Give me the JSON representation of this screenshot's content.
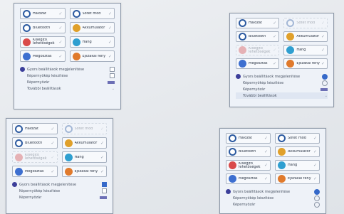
{
  "panels": [
    {
      "tiles": [
        {
          "label": "Hálózat",
          "icon": "wifi-icon",
          "color": "#2c5aa0",
          "dim": false
        },
        {
          "label": "Sötét mód",
          "icon": "moon-icon",
          "color": "#2c5aa0",
          "dim": false
        },
        {
          "label": "Bluetooth",
          "icon": "bluetooth-icon",
          "color": "#2c5aa0",
          "dim": false
        },
        {
          "label": "Akkumulátor",
          "icon": "battery-icon",
          "color": "#e0a02a",
          "dim": false
        },
        {
          "label": "Kisegítő lehetőségek",
          "icon": "accessibility-icon",
          "color": "#d94a4a",
          "dim": false
        },
        {
          "label": "Hang",
          "icon": "volume-icon",
          "color": "#2f9fd0",
          "dim": false
        },
        {
          "label": "Megosztás",
          "icon": "share-icon",
          "color": "#3d6fd0",
          "dim": false
        },
        {
          "label": "Éjszakai fény",
          "icon": "night-light-icon",
          "color": "#e07a2c",
          "dim": false
        }
      ],
      "options": [
        {
          "label": "Gyors beállítások megjelenítése",
          "kind": "checkbox",
          "on": false,
          "icon_color": "#3c3f9a"
        },
        {
          "label": "Képernyőkép készítése",
          "kind": "checkbox",
          "on": false,
          "icon_color": ""
        },
        {
          "label": "Képernyőzár",
          "kind": "bar",
          "on": false,
          "icon_color": ""
        },
        {
          "label": "További beállítások",
          "kind": "dropdown",
          "on": false,
          "icon_color": ""
        }
      ]
    },
    {
      "tiles": [
        {
          "label": "Hálózat",
          "icon": "wifi-icon",
          "color": "#2c5aa0",
          "dim": false
        },
        {
          "label": "Sötét mód",
          "icon": "moon-icon",
          "color": "#2c5aa0",
          "dim": true
        },
        {
          "label": "Bluetooth",
          "icon": "bluetooth-icon",
          "color": "#2c5aa0",
          "dim": false
        },
        {
          "label": "Akkumulátor",
          "icon": "battery-icon",
          "color": "#e0a02a",
          "dim": false
        },
        {
          "label": "Kisegítő lehetőségek",
          "icon": "accessibility-icon",
          "color": "#d94a4a",
          "dim": true
        },
        {
          "label": "Hang",
          "icon": "volume-icon",
          "color": "#2f9fd0",
          "dim": false
        },
        {
          "label": "Megosztás",
          "icon": "share-icon",
          "color": "#3d6fd0",
          "dim": false
        },
        {
          "label": "Éjszakai fény",
          "icon": "night-light-icon",
          "color": "#e07a2c",
          "dim": false
        }
      ],
      "options": [
        {
          "label": "Gyors beállítások megjelenítése",
          "kind": "radio",
          "on": true,
          "icon_color": "#3c3f9a"
        },
        {
          "label": "Képernyőkép készítése",
          "kind": "radio",
          "on": false,
          "icon_color": ""
        },
        {
          "label": "Képernyőzár",
          "kind": "bar",
          "on": false,
          "icon_color": ""
        },
        {
          "label": "További beállítások",
          "kind": "dropdown",
          "on": false,
          "icon_color": "",
          "selected": true
        }
      ]
    },
    {
      "tiles": [
        {
          "label": "Hálózat",
          "icon": "wifi-icon",
          "color": "#2c5aa0",
          "dim": false
        },
        {
          "label": "Sötét mód",
          "icon": "moon-icon",
          "color": "#2c5aa0",
          "dim": true
        },
        {
          "label": "Bluetooth",
          "icon": "bluetooth-icon",
          "color": "#2c5aa0",
          "dim": false
        },
        {
          "label": "Akkumulátor",
          "icon": "battery-icon",
          "color": "#e0a02a",
          "dim": false
        },
        {
          "label": "Kisegítő lehetőségek",
          "icon": "accessibility-icon",
          "color": "#d94a4a",
          "dim": true
        },
        {
          "label": "Hang",
          "icon": "volume-icon",
          "color": "#2f9fd0",
          "dim": false
        },
        {
          "label": "Megosztás",
          "icon": "share-icon",
          "color": "#3d6fd0",
          "dim": false
        },
        {
          "label": "Éjszakai fény",
          "icon": "night-light-icon",
          "color": "#e07a2c",
          "dim": false
        }
      ],
      "options": [
        {
          "label": "Gyors beállítások megjelenítése",
          "kind": "checkbox",
          "on": true,
          "icon_color": "#3c3f9a"
        },
        {
          "label": "Képernyőkép készítése",
          "kind": "checkbox",
          "on": false,
          "icon_color": ""
        },
        {
          "label": "Képernyőzár",
          "kind": "bar",
          "on": false,
          "icon_color": ""
        }
      ]
    },
    {
      "tiles": [
        {
          "label": "Hálózat",
          "icon": "wifi-icon",
          "color": "#2c5aa0",
          "dim": false
        },
        {
          "label": "Sötét mód",
          "icon": "moon-icon",
          "color": "#2c5aa0",
          "dim": false
        },
        {
          "label": "Bluetooth",
          "icon": "bluetooth-icon",
          "color": "#2c5aa0",
          "dim": false
        },
        {
          "label": "Akkumulátor",
          "icon": "battery-icon",
          "color": "#e0a02a",
          "dim": false
        },
        {
          "label": "Kisegítő lehetőségek",
          "icon": "accessibility-icon",
          "color": "#d94a4a",
          "dim": false
        },
        {
          "label": "Hang",
          "icon": "volume-icon",
          "color": "#2f9fd0",
          "dim": false
        },
        {
          "label": "Megosztás",
          "icon": "share-icon",
          "color": "#3d6fd0",
          "dim": false
        },
        {
          "label": "Éjszakai fény",
          "icon": "night-light-icon",
          "color": "#e07a2c",
          "dim": false
        }
      ],
      "options": [
        {
          "label": "Gyors beállítások megjelenítése",
          "kind": "radio",
          "on": true,
          "icon_color": "#3c3f9a"
        },
        {
          "label": "Képernyőkép készítése",
          "kind": "radio",
          "on": false,
          "icon_color": ""
        },
        {
          "label": "Képernyőzár",
          "kind": "radio",
          "on": false,
          "icon_color": ""
        }
      ]
    }
  ],
  "glyphs": {
    "chevron": "✓",
    "dropdown": "⌄"
  }
}
